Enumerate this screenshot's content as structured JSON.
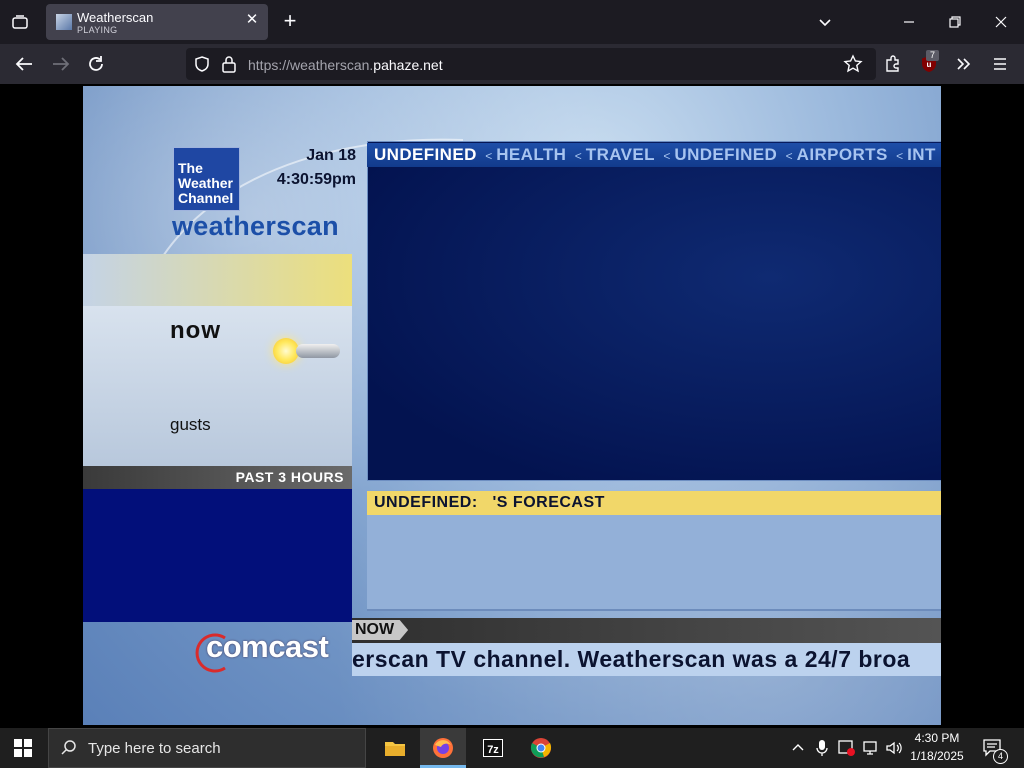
{
  "browser": {
    "tab": {
      "title": "Weatherscan",
      "status": "PLAYING"
    },
    "url": {
      "prefix": "https://weatherscan.",
      "domain": "pahaze.net"
    },
    "extension_badge": "7"
  },
  "page": {
    "logo": {
      "line1": "The",
      "line2": "Weather",
      "line3": "Channel"
    },
    "wordmark": "weatherscan",
    "date": "Jan 18",
    "time": "4:30:59pm",
    "now_label": "now",
    "gusts_label": "gusts",
    "past_label": "PAST 3 HOURS",
    "ticker": {
      "active": "UNDEFINED",
      "items": [
        "HEALTH",
        "TRAVEL",
        "UNDEFINED",
        "AIRPORTS",
        "INT"
      ]
    },
    "forecast_label": "UNDEFINED:   'S FORECAST",
    "now_tag": "NOW",
    "crawl_text": "erscan TV channel. Weatherscan was a 24/7 broa",
    "sponsor": "comcast"
  },
  "taskbar": {
    "search_placeholder": "Type here to search",
    "apps": [
      "file-explorer",
      "firefox",
      "7-zip",
      "chrome"
    ],
    "clock_time": "4:30 PM",
    "clock_date": "1/18/2025",
    "notification_count": "4"
  }
}
